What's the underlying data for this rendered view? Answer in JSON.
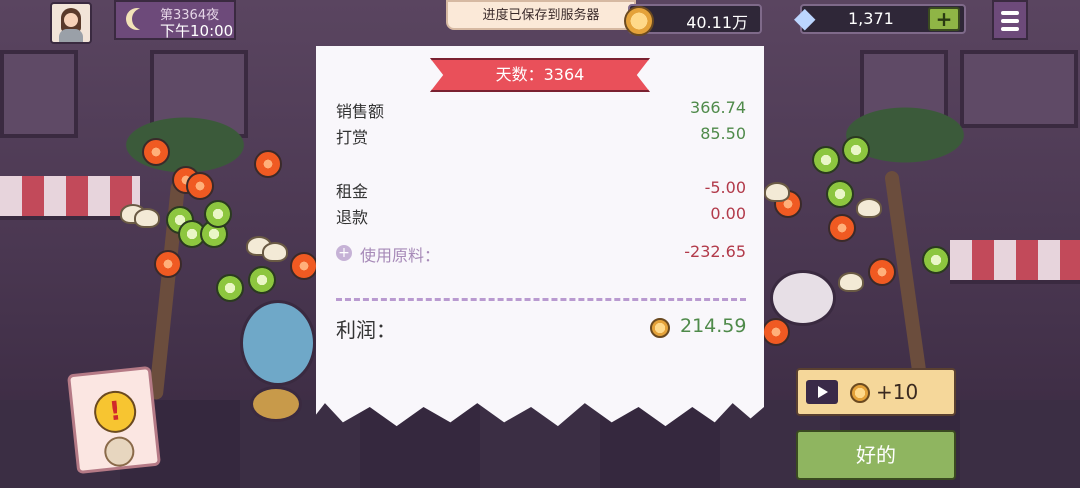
{
  "hud": {
    "night_label": "第3364夜",
    "time_label": "下午10:00",
    "coins": "40.11万",
    "gems": "1,371",
    "plus_label": "+",
    "toast": "进度已保存到服务器"
  },
  "receipt": {
    "title": "天数：3364",
    "sales_label": "销售额",
    "sales_value": "366.74",
    "tips_label": "打赏",
    "tips_value": "85.50",
    "rent_label": "租金",
    "rent_value": "-5.00",
    "refund_label": "退款",
    "refund_value": "0.00",
    "ingredients_label": "使用原料：",
    "ingredients_value": "-232.65",
    "profit_label": "利润：",
    "profit_value": "214.59"
  },
  "actions": {
    "ad_reward": "+10",
    "ok_label": "好的"
  },
  "icons": {
    "moon": "moon-icon",
    "coin": "coin-icon",
    "gem": "diamond-icon",
    "menu": "hamburger-menu-icon",
    "play": "video-play-icon",
    "alert": "exclamation-alert-icon"
  },
  "colors": {
    "positive": "#4f8a4a",
    "negative": "#b23a4a",
    "ribbon": "#e9505a",
    "ok_button": "#8fb560",
    "ad_button": "#f5d79a"
  }
}
